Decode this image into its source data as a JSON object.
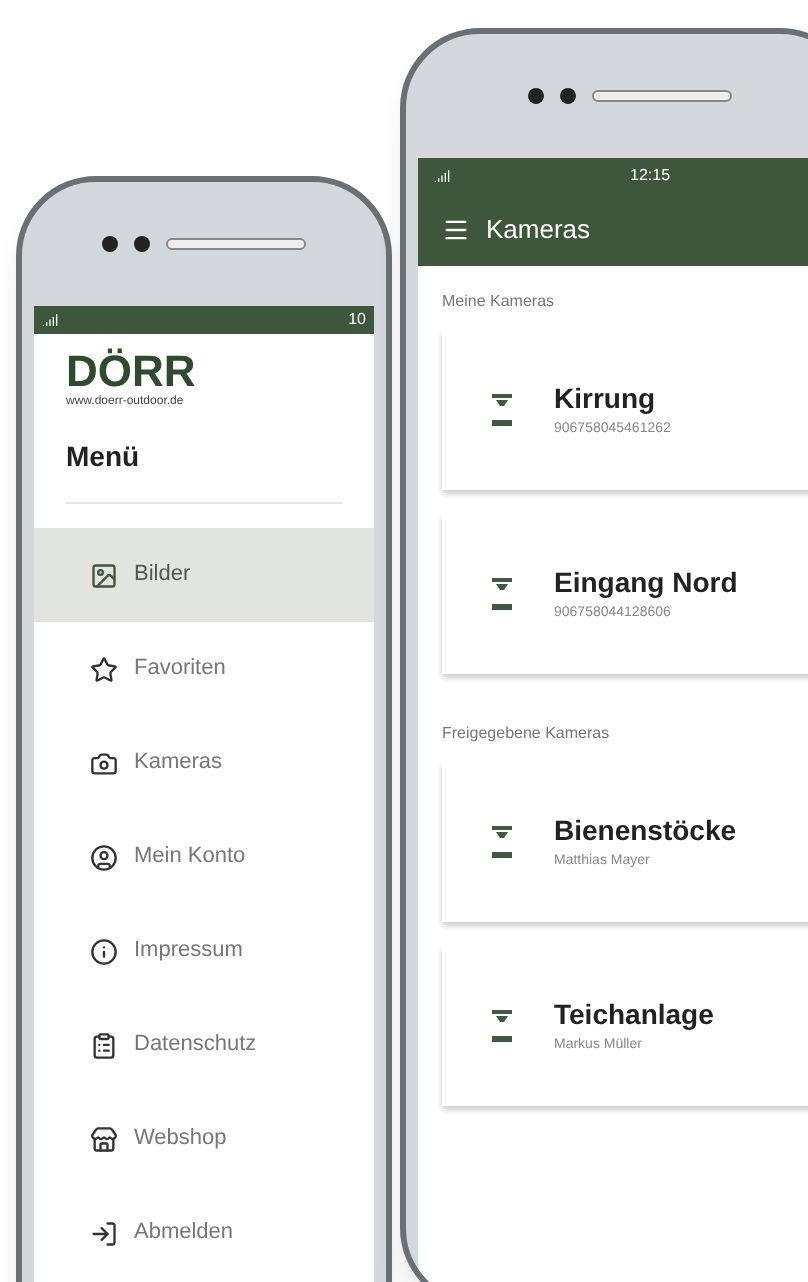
{
  "menu_phone": {
    "status_time": "10",
    "logo": "DÖRR",
    "logo_url": "www.doerr-outdoor.de",
    "title": "Menü",
    "items": [
      {
        "label": "Bilder",
        "selected": true
      },
      {
        "label": "Favoriten",
        "selected": false
      },
      {
        "label": "Kameras",
        "selected": false
      },
      {
        "label": "Mein Konto",
        "selected": false
      },
      {
        "label": "Impressum",
        "selected": false
      },
      {
        "label": "Datenschutz",
        "selected": false
      },
      {
        "label": "Webshop",
        "selected": false
      },
      {
        "label": "Abmelden",
        "selected": false
      }
    ]
  },
  "camera_phone": {
    "status_time": "12:15",
    "title": "Kameras",
    "sections": [
      {
        "heading": "Meine Kameras",
        "cameras": [
          {
            "name": "Kirrung",
            "detail": "906758045461262"
          },
          {
            "name": "Eingang Nord",
            "detail": "906758044128606"
          }
        ]
      },
      {
        "heading": "Freigegebene Kameras",
        "cameras": [
          {
            "name": "Bienenstöcke",
            "detail": "Matthias Mayer"
          },
          {
            "name": "Teichanlage",
            "detail": "Markus Müller"
          }
        ]
      }
    ]
  }
}
